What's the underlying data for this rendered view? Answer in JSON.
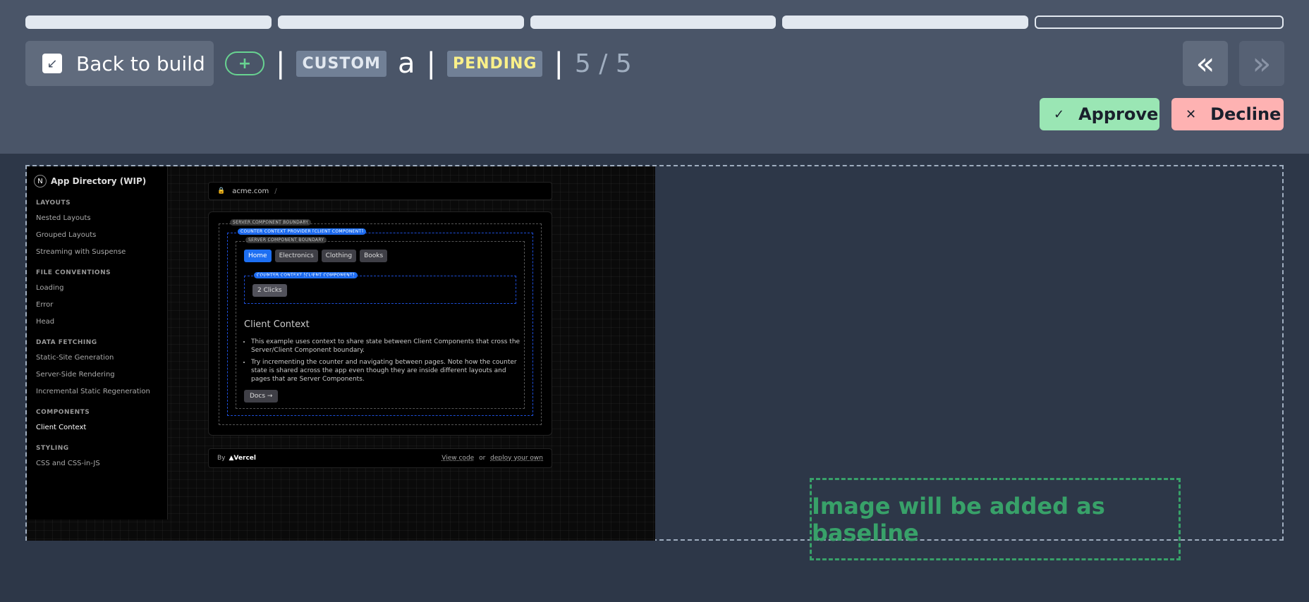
{
  "progress": {
    "segments": 5,
    "current": 5
  },
  "toolbar": {
    "back_label": "Back to build",
    "add_label": "+",
    "separator": "|",
    "type_tag": "CUSTOM",
    "name": "a",
    "status": "PENDING",
    "counter": "5 / 5",
    "prev_icon": "«",
    "next_icon": "»",
    "approve_label": "Approve",
    "decline_label": "Decline"
  },
  "screenshot": {
    "sidebar": {
      "title": "App Directory (WIP)",
      "sections": [
        {
          "label": "LAYOUTS",
          "items": [
            "Nested Layouts",
            "Grouped Layouts",
            "Streaming with Suspense"
          ]
        },
        {
          "label": "FILE CONVENTIONS",
          "items": [
            "Loading",
            "Error",
            "Head"
          ]
        },
        {
          "label": "DATA FETCHING",
          "items": [
            "Static-Site Generation",
            "Server-Side Rendering",
            "Incremental Static Regeneration"
          ]
        },
        {
          "label": "COMPONENTS",
          "items": [
            "Client Context"
          ]
        },
        {
          "label": "STYLING",
          "items": [
            "CSS and CSS-in-JS"
          ]
        }
      ],
      "active_item": "Client Context"
    },
    "address": {
      "host": "acme.com",
      "path": "/"
    },
    "labels": {
      "server_boundary": "SERVER COMPONENT BOUNDARY",
      "provider": "COUNTER CONTEXT PROVIDER [CLIENT COMPONENT]",
      "inner_server_boundary": "SERVER COMPONENT BOUNDARY",
      "client_component": "COUNTER CONTEXT [CLIENT COMPONENT]"
    },
    "tabs": [
      "Home",
      "Electronics",
      "Clothing",
      "Books"
    ],
    "clicks_label": "2 Clicks",
    "heading": "Client Context",
    "bullets": [
      "This example uses context to share state between Client Components that cross the Server/Client Component boundary.",
      "Try incrementing the counter and navigating between pages. Note how the counter state is shared across the app even though they are inside different layouts and pages that are Server Components."
    ],
    "docs_label": "Docs →",
    "footer": {
      "by": "By",
      "brand": "▲Vercel",
      "view_code": "View code",
      "or": "or",
      "deploy": "deploy your own"
    }
  },
  "baseline_message": "Image will be added as baseline"
}
